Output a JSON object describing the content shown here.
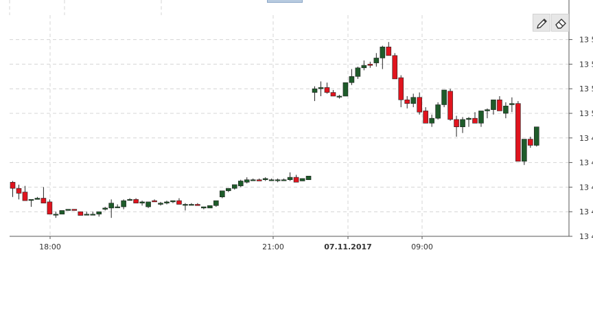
{
  "toolbar": {
    "draw_icon": "pencil-icon",
    "erase_icon": "eraser-icon"
  },
  "colors": {
    "up": "#1e5b2a",
    "down": "#e0141e",
    "grid": "#d4d4d4",
    "axis": "#555555",
    "text": "#333333"
  },
  "chart_data": {
    "type": "candlestick",
    "x_tick_labels": [
      {
        "label": "18:00",
        "bold": false
      },
      {
        "label": "21:00",
        "bold": false
      },
      {
        "label": "07.11.2017",
        "bold": true
      },
      {
        "label": "09:00",
        "bold": false
      }
    ],
    "y_tick_labels": [
      "13 5",
      "13 5",
      "13 5",
      "13 5",
      "13 4",
      "13 4",
      "13 4",
      "13 4",
      "13 4"
    ],
    "y_ticks": [
      8,
      7,
      6,
      5,
      4,
      3,
      2,
      1,
      0
    ],
    "ylim": [
      0,
      8.5
    ],
    "grid": true,
    "candles": [
      [
        2.2,
        2.25,
        1.6,
        1.95
      ],
      [
        1.95,
        2.1,
        1.5,
        1.75
      ],
      [
        1.8,
        2.05,
        1.55,
        1.45
      ],
      [
        1.5,
        1.5,
        1.2,
        1.5
      ],
      [
        1.5,
        1.6,
        1.5,
        1.55
      ],
      [
        1.55,
        2.0,
        1.5,
        1.35
      ],
      [
        1.4,
        1.5,
        0.95,
        0.9
      ],
      [
        0.9,
        1.0,
        0.75,
        0.9
      ],
      [
        0.9,
        1.05,
        0.9,
        1.05
      ],
      [
        1.05,
        1.1,
        1.05,
        1.1
      ],
      [
        1.1,
        1.1,
        1.05,
        1.05
      ],
      [
        1.0,
        1.0,
        0.85,
        0.85
      ],
      [
        0.9,
        1.0,
        0.9,
        0.9
      ],
      [
        0.9,
        1.0,
        0.9,
        0.9
      ],
      [
        0.9,
        1.0,
        0.8,
        1.0
      ],
      [
        1.1,
        1.2,
        1.05,
        1.15
      ],
      [
        1.15,
        1.5,
        0.75,
        1.35
      ],
      [
        1.2,
        1.3,
        1.15,
        1.2
      ],
      [
        1.2,
        1.5,
        1.1,
        1.45
      ],
      [
        1.5,
        1.55,
        1.45,
        1.5
      ],
      [
        1.5,
        1.55,
        1.35,
        1.35
      ],
      [
        1.35,
        1.45,
        1.25,
        1.4
      ],
      [
        1.2,
        1.3,
        1.15,
        1.4
      ],
      [
        1.45,
        1.5,
        1.4,
        1.4
      ],
      [
        1.3,
        1.4,
        1.25,
        1.35
      ],
      [
        1.35,
        1.45,
        1.3,
        1.4
      ],
      [
        1.4,
        1.45,
        1.35,
        1.45
      ],
      [
        1.45,
        1.55,
        1.4,
        1.3
      ],
      [
        1.3,
        1.35,
        1.05,
        1.3
      ],
      [
        1.3,
        1.35,
        1.3,
        1.3
      ],
      [
        1.3,
        1.35,
        1.3,
        1.25
      ],
      [
        1.15,
        1.2,
        1.1,
        1.2
      ],
      [
        1.15,
        1.2,
        1.15,
        1.25
      ],
      [
        1.25,
        1.3,
        1.2,
        1.45
      ],
      [
        1.6,
        1.85,
        1.55,
        1.85
      ],
      [
        1.85,
        1.9,
        1.8,
        1.95
      ],
      [
        1.95,
        2.05,
        1.9,
        2.1
      ],
      [
        2.05,
        2.3,
        2.0,
        2.25
      ],
      [
        2.2,
        2.4,
        2.15,
        2.3
      ],
      [
        2.3,
        2.35,
        2.25,
        2.3
      ],
      [
        2.3,
        2.35,
        2.25,
        2.25
      ],
      [
        2.3,
        2.4,
        2.25,
        2.35
      ],
      [
        2.3,
        2.35,
        2.25,
        2.3
      ],
      [
        2.3,
        2.35,
        2.2,
        2.3
      ],
      [
        2.3,
        2.35,
        2.3,
        2.3
      ],
      [
        2.3,
        2.6,
        2.25,
        2.4
      ],
      [
        2.4,
        2.5,
        2.25,
        2.2
      ],
      [
        2.25,
        2.35,
        2.25,
        2.35
      ],
      [
        2.3,
        2.4,
        2.3,
        2.45
      ],
      [
        5.85,
        6.1,
        5.5,
        6.0
      ],
      [
        6.0,
        6.3,
        5.7,
        6.05
      ],
      [
        6.05,
        6.25,
        5.8,
        5.85
      ],
      [
        5.85,
        5.95,
        5.7,
        5.7
      ],
      [
        5.7,
        5.75,
        5.6,
        5.7
      ],
      [
        5.7,
        6.2,
        5.7,
        6.25
      ],
      [
        6.25,
        6.8,
        6.15,
        6.5
      ],
      [
        6.5,
        6.9,
        6.4,
        6.85
      ],
      [
        6.85,
        7.15,
        6.75,
        6.95
      ],
      [
        7.0,
        7.1,
        6.85,
        6.95
      ],
      [
        7.05,
        7.45,
        6.9,
        7.25
      ],
      [
        7.25,
        7.75,
        6.8,
        7.7
      ],
      [
        7.7,
        7.9,
        7.35,
        7.35
      ],
      [
        7.35,
        7.45,
        6.45,
        6.4
      ],
      [
        6.45,
        6.55,
        5.25,
        5.55
      ],
      [
        5.55,
        5.7,
        5.2,
        5.4
      ],
      [
        5.4,
        5.8,
        5.25,
        5.65
      ],
      [
        5.65,
        5.85,
        4.95,
        5.05
      ],
      [
        5.1,
        5.25,
        4.6,
        4.6
      ],
      [
        4.6,
        4.95,
        4.45,
        4.8
      ],
      [
        4.8,
        5.45,
        4.75,
        5.35
      ],
      [
        5.35,
        5.9,
        5.25,
        5.95
      ],
      [
        5.9,
        6.0,
        4.7,
        4.75
      ],
      [
        4.75,
        4.9,
        4.05,
        4.45
      ],
      [
        4.45,
        4.85,
        4.2,
        4.75
      ],
      [
        4.75,
        4.85,
        4.45,
        4.8
      ],
      [
        4.8,
        5.05,
        4.75,
        4.6
      ],
      [
        4.6,
        4.7,
        4.45,
        5.1
      ],
      [
        5.1,
        5.2,
        4.8,
        5.15
      ],
      [
        5.15,
        5.55,
        4.95,
        5.55
      ],
      [
        5.55,
        5.7,
        5.2,
        5.1
      ],
      [
        5.0,
        5.45,
        4.8,
        5.3
      ],
      [
        5.35,
        5.65,
        5.05,
        5.4
      ],
      [
        5.4,
        5.5,
        4.2,
        3.05
      ],
      [
        3.05,
        3.45,
        2.9,
        3.95
      ],
      [
        3.95,
        4.05,
        3.6,
        3.7
      ],
      [
        3.7,
        4.1,
        3.65,
        4.45
      ]
    ]
  }
}
